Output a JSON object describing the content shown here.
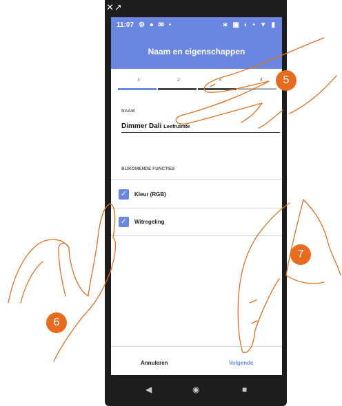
{
  "status_bar": {
    "time": "11:07",
    "left_icons": "⚙ ● ✉ •",
    "right_icons": "∗ ▣ ◐ • ▼ ▮"
  },
  "top_icons": "✕↗",
  "header": {
    "title": "Naam en eigenschappen"
  },
  "stepper": {
    "steps": [
      "1",
      "2",
      "3",
      "4"
    ],
    "current_step": 1
  },
  "name_section": {
    "label": "NAAM",
    "value_main": "Dimmer Dali",
    "value_suffix": "Leefruimte"
  },
  "functions_section": {
    "label": "BIJKOMENDE FUNCTIES",
    "options": [
      {
        "label": "Kleur (RGB)",
        "checked": true
      },
      {
        "label": "Witregeling",
        "checked": true
      }
    ]
  },
  "footer": {
    "cancel_label": "Annuleren",
    "next_label": "Volgende"
  },
  "nav": {
    "back": "◀",
    "home": "◉",
    "recents": "■"
  },
  "callouts": [
    "5",
    "6",
    "7"
  ],
  "colors": {
    "accent": "#6b86e0",
    "callout": "#e86c1f",
    "hand_stroke": "#e07020"
  }
}
